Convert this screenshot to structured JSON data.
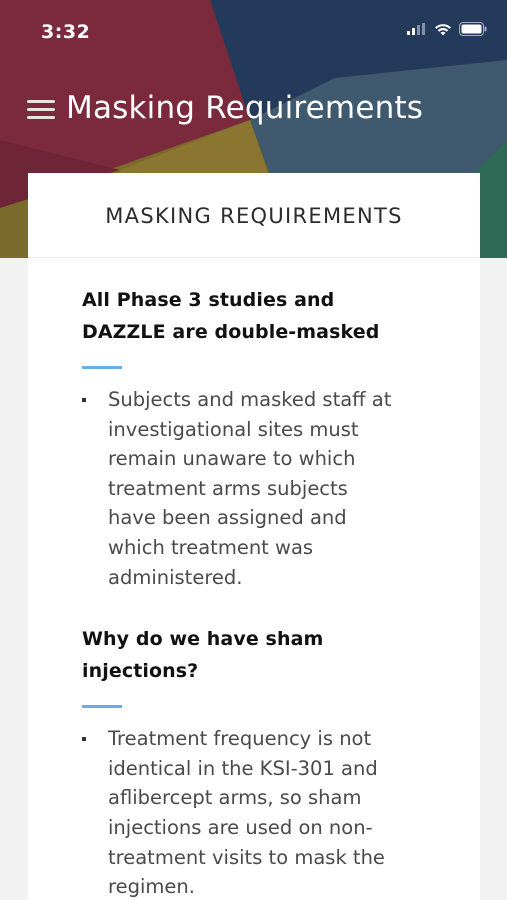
{
  "status_bar": {
    "time": "3:32",
    "icons": [
      "cellular-signal-icon",
      "wifi-icon",
      "battery-icon"
    ]
  },
  "app_bar": {
    "menu_icon": "hamburger-menu-icon",
    "title": "Masking Requirements"
  },
  "hero_colors": {
    "maroon": "#7b2a3e",
    "navy": "#233a5a",
    "olive": "#7a6a2b",
    "slate": "#3f5a6f",
    "teal": "#2f6a57"
  },
  "card": {
    "title": "MASKING REQUIREMENTS",
    "sections": [
      {
        "heading_lines": [
          "All Phase 3 studies and",
          "DAZZLE are double-masked"
        ],
        "bullet_lines": [
          "Subjects and masked staff at",
          "investigational sites must",
          "remain unaware to which",
          "treatment arms subjects",
          "have been assigned and",
          "which treatment was",
          "administered."
        ]
      },
      {
        "heading_lines": [
          "Why do we have sham",
          "injections?"
        ],
        "bullet_lines": [
          "Treatment frequency is not",
          "identical in the KSI-301 and",
          "aflibercept arms, so sham",
          "injections are used on non-",
          "treatment visits to mask the",
          "regimen."
        ]
      }
    ]
  },
  "accent_color": "#6aaee5"
}
